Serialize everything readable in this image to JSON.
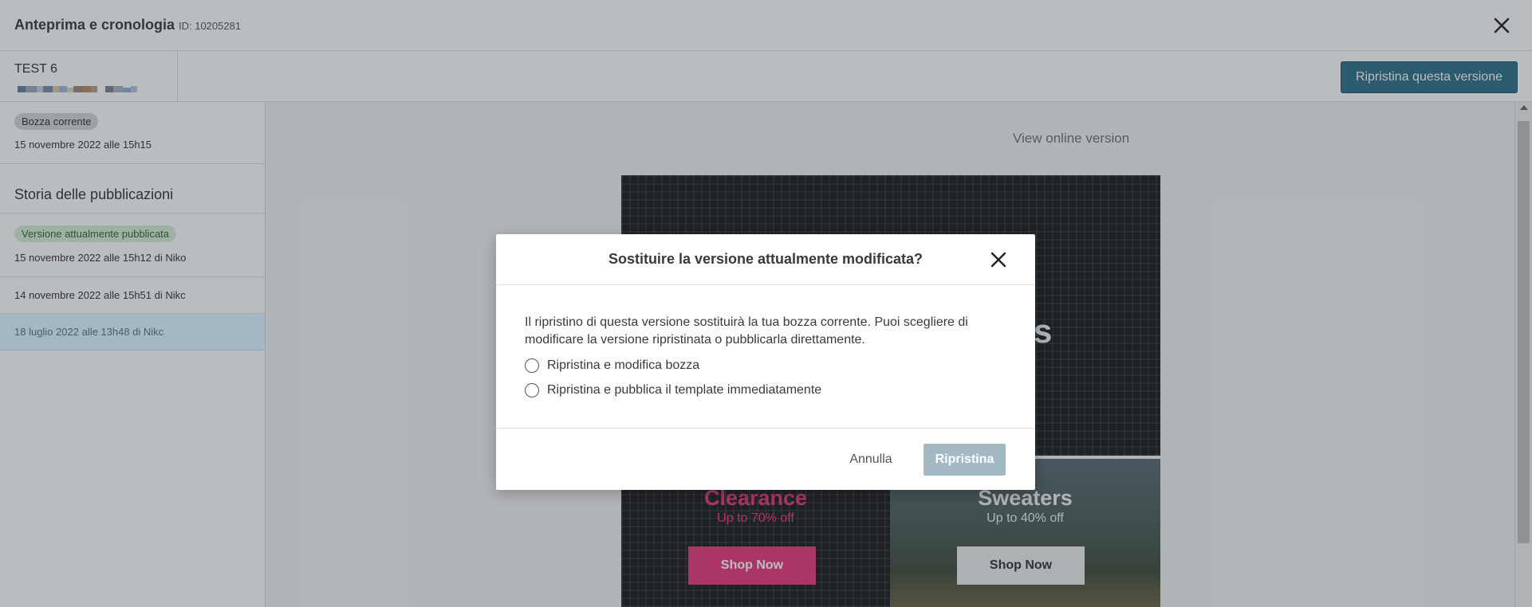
{
  "header": {
    "title": "Anteprima e cronologia",
    "id_label": "ID: 10205281"
  },
  "toolbar": {
    "template_name": "TEST 6",
    "restore_version_label": "Ripristina questa versione"
  },
  "sidebar": {
    "current_draft": {
      "badge": "Bozza corrente",
      "date": "15 novembre 2022 alle 15h15"
    },
    "history_heading": "Storia delle pubblicazioni",
    "published": {
      "badge": "Versione attualmente pubblicata",
      "date": "15 novembre 2022 alle 15h12 di Niko"
    },
    "items": [
      {
        "date": "14 novembre 2022 alle 15h51 di Nikc",
        "selected": false
      },
      {
        "date": "18 luglio 2022 alle 13h48 di Nikc",
        "selected": true
      }
    ]
  },
  "preview": {
    "view_online": "View online version",
    "hero_partial_text": "s",
    "tiles": [
      {
        "title": "Clearance",
        "subtitle": "Up to 70% off",
        "button": "Shop Now",
        "color": "#e9397a"
      },
      {
        "title": "Sweaters",
        "subtitle": "Up to 40% off",
        "button": "Shop Now"
      }
    ]
  },
  "modal": {
    "title": "Sostituire la versione attualmente modificata?",
    "body": "Il ripristino di questa versione sostituirà la tua bozza corrente. Puoi scegliere di modificare la versione ripristinata o pubblicarla direttamente.",
    "options": [
      {
        "label": "Ripristina e modifica bozza",
        "checked": false
      },
      {
        "label": "Ripristina e pubblica il template immediatamente",
        "checked": false
      }
    ],
    "cancel_label": "Annulla",
    "confirm_label": "Ripristina",
    "confirm_enabled": false
  },
  "colors": {
    "primary": "#2e6d86",
    "disabled_button": "#a3bac4",
    "pink_accent": "#e9397a",
    "published_badge": "#d7edd4"
  },
  "icons": {
    "window_close": "close-icon",
    "modal_close": "close-icon"
  }
}
